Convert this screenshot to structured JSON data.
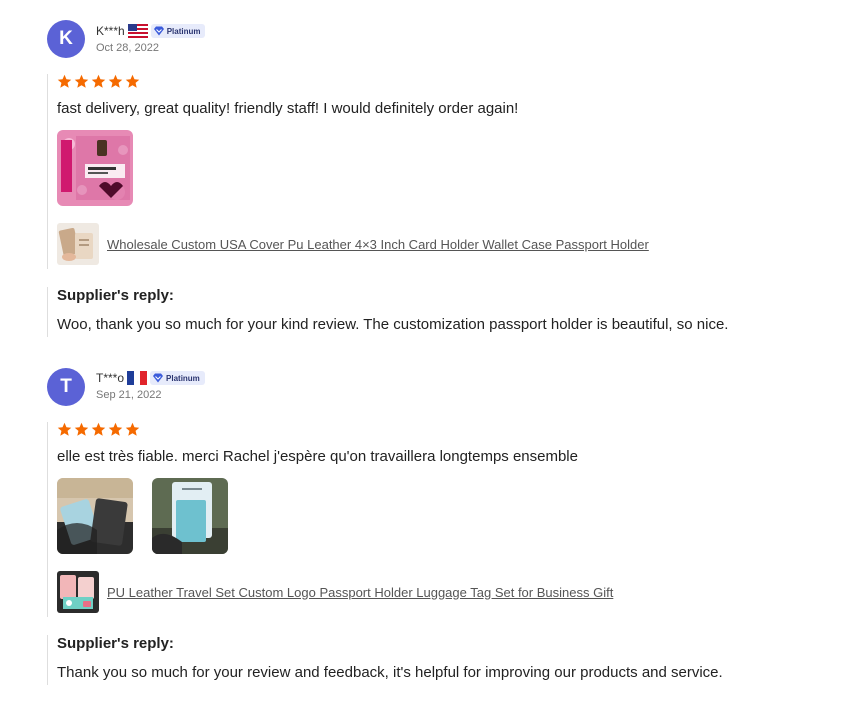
{
  "reviews": [
    {
      "avatar_letter": "K",
      "avatar_color": "#5b62d6",
      "name": "K***h",
      "flag": "us-flag",
      "badge": "Platinum",
      "date": "Oct 28, 2022",
      "rating": 5,
      "comment": "fast delivery, great quality! friendly staff! I would definitely order again!",
      "photo_count": 1,
      "product_title": "Wholesale Custom USA Cover Pu Leather 4×3 Inch Card Holder Wallet Case Passport Holder",
      "reply_title": "Supplier's reply:",
      "reply_text": "Woo, thank you so much for your kind review. The customization passport holder is beautiful, so nice."
    },
    {
      "avatar_letter": "T",
      "avatar_color": "#5b62d6",
      "name": "T***o",
      "flag": "fr-flag",
      "badge": "Platinum",
      "date": "Sep 21, 2022",
      "rating": 5,
      "comment": "elle est très fiable. merci Rachel j'espère qu'on travaillera longtemps ensemble",
      "photo_count": 2,
      "product_title": "PU Leather Travel Set Custom Logo Passport Holder Luggage Tag Set for Business Gift",
      "reply_title": "Supplier's reply:",
      "reply_text": "Thank you so much for your review and feedback, it's helpful for improving our products and service."
    }
  ],
  "colors": {
    "star": "#f56a00",
    "avatar": "#5b62d6",
    "badge_bg": "#e7ebfb"
  }
}
